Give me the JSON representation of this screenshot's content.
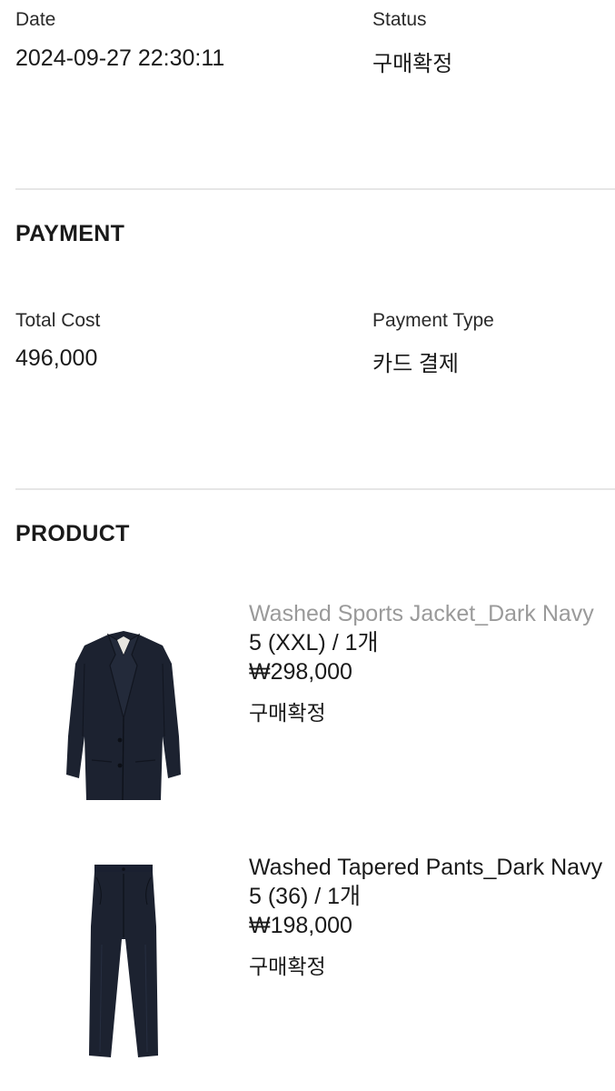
{
  "order": {
    "date_label": "Date",
    "date_value": "2024-09-27 22:30:11",
    "status_label": "Status",
    "status_value": "구매확정"
  },
  "payment": {
    "title": "PAYMENT",
    "total_cost_label": "Total Cost",
    "total_cost_value": "496,000",
    "payment_type_label": "Payment Type",
    "payment_type_value": "카드 결제"
  },
  "product": {
    "title": "PRODUCT",
    "items": [
      {
        "name": "Washed Sports Jacket_Dark Navy",
        "option": "5 (XXL) / 1개",
        "price": "₩298,000",
        "status": "구매확정",
        "image": "navy-jacket-image",
        "color": "#1c2230"
      },
      {
        "name": "Washed Tapered Pants_Dark Navy",
        "option": "5 (36) / 1개",
        "price": "₩198,000",
        "status": "구매확정",
        "image": "navy-pants-image",
        "color": "#1c2230"
      }
    ]
  },
  "colors": {
    "text": "#1a1a1a",
    "muted_text": "#9a9a9a",
    "divider": "#e6e6e6",
    "garment_navy": "#1c2230"
  }
}
